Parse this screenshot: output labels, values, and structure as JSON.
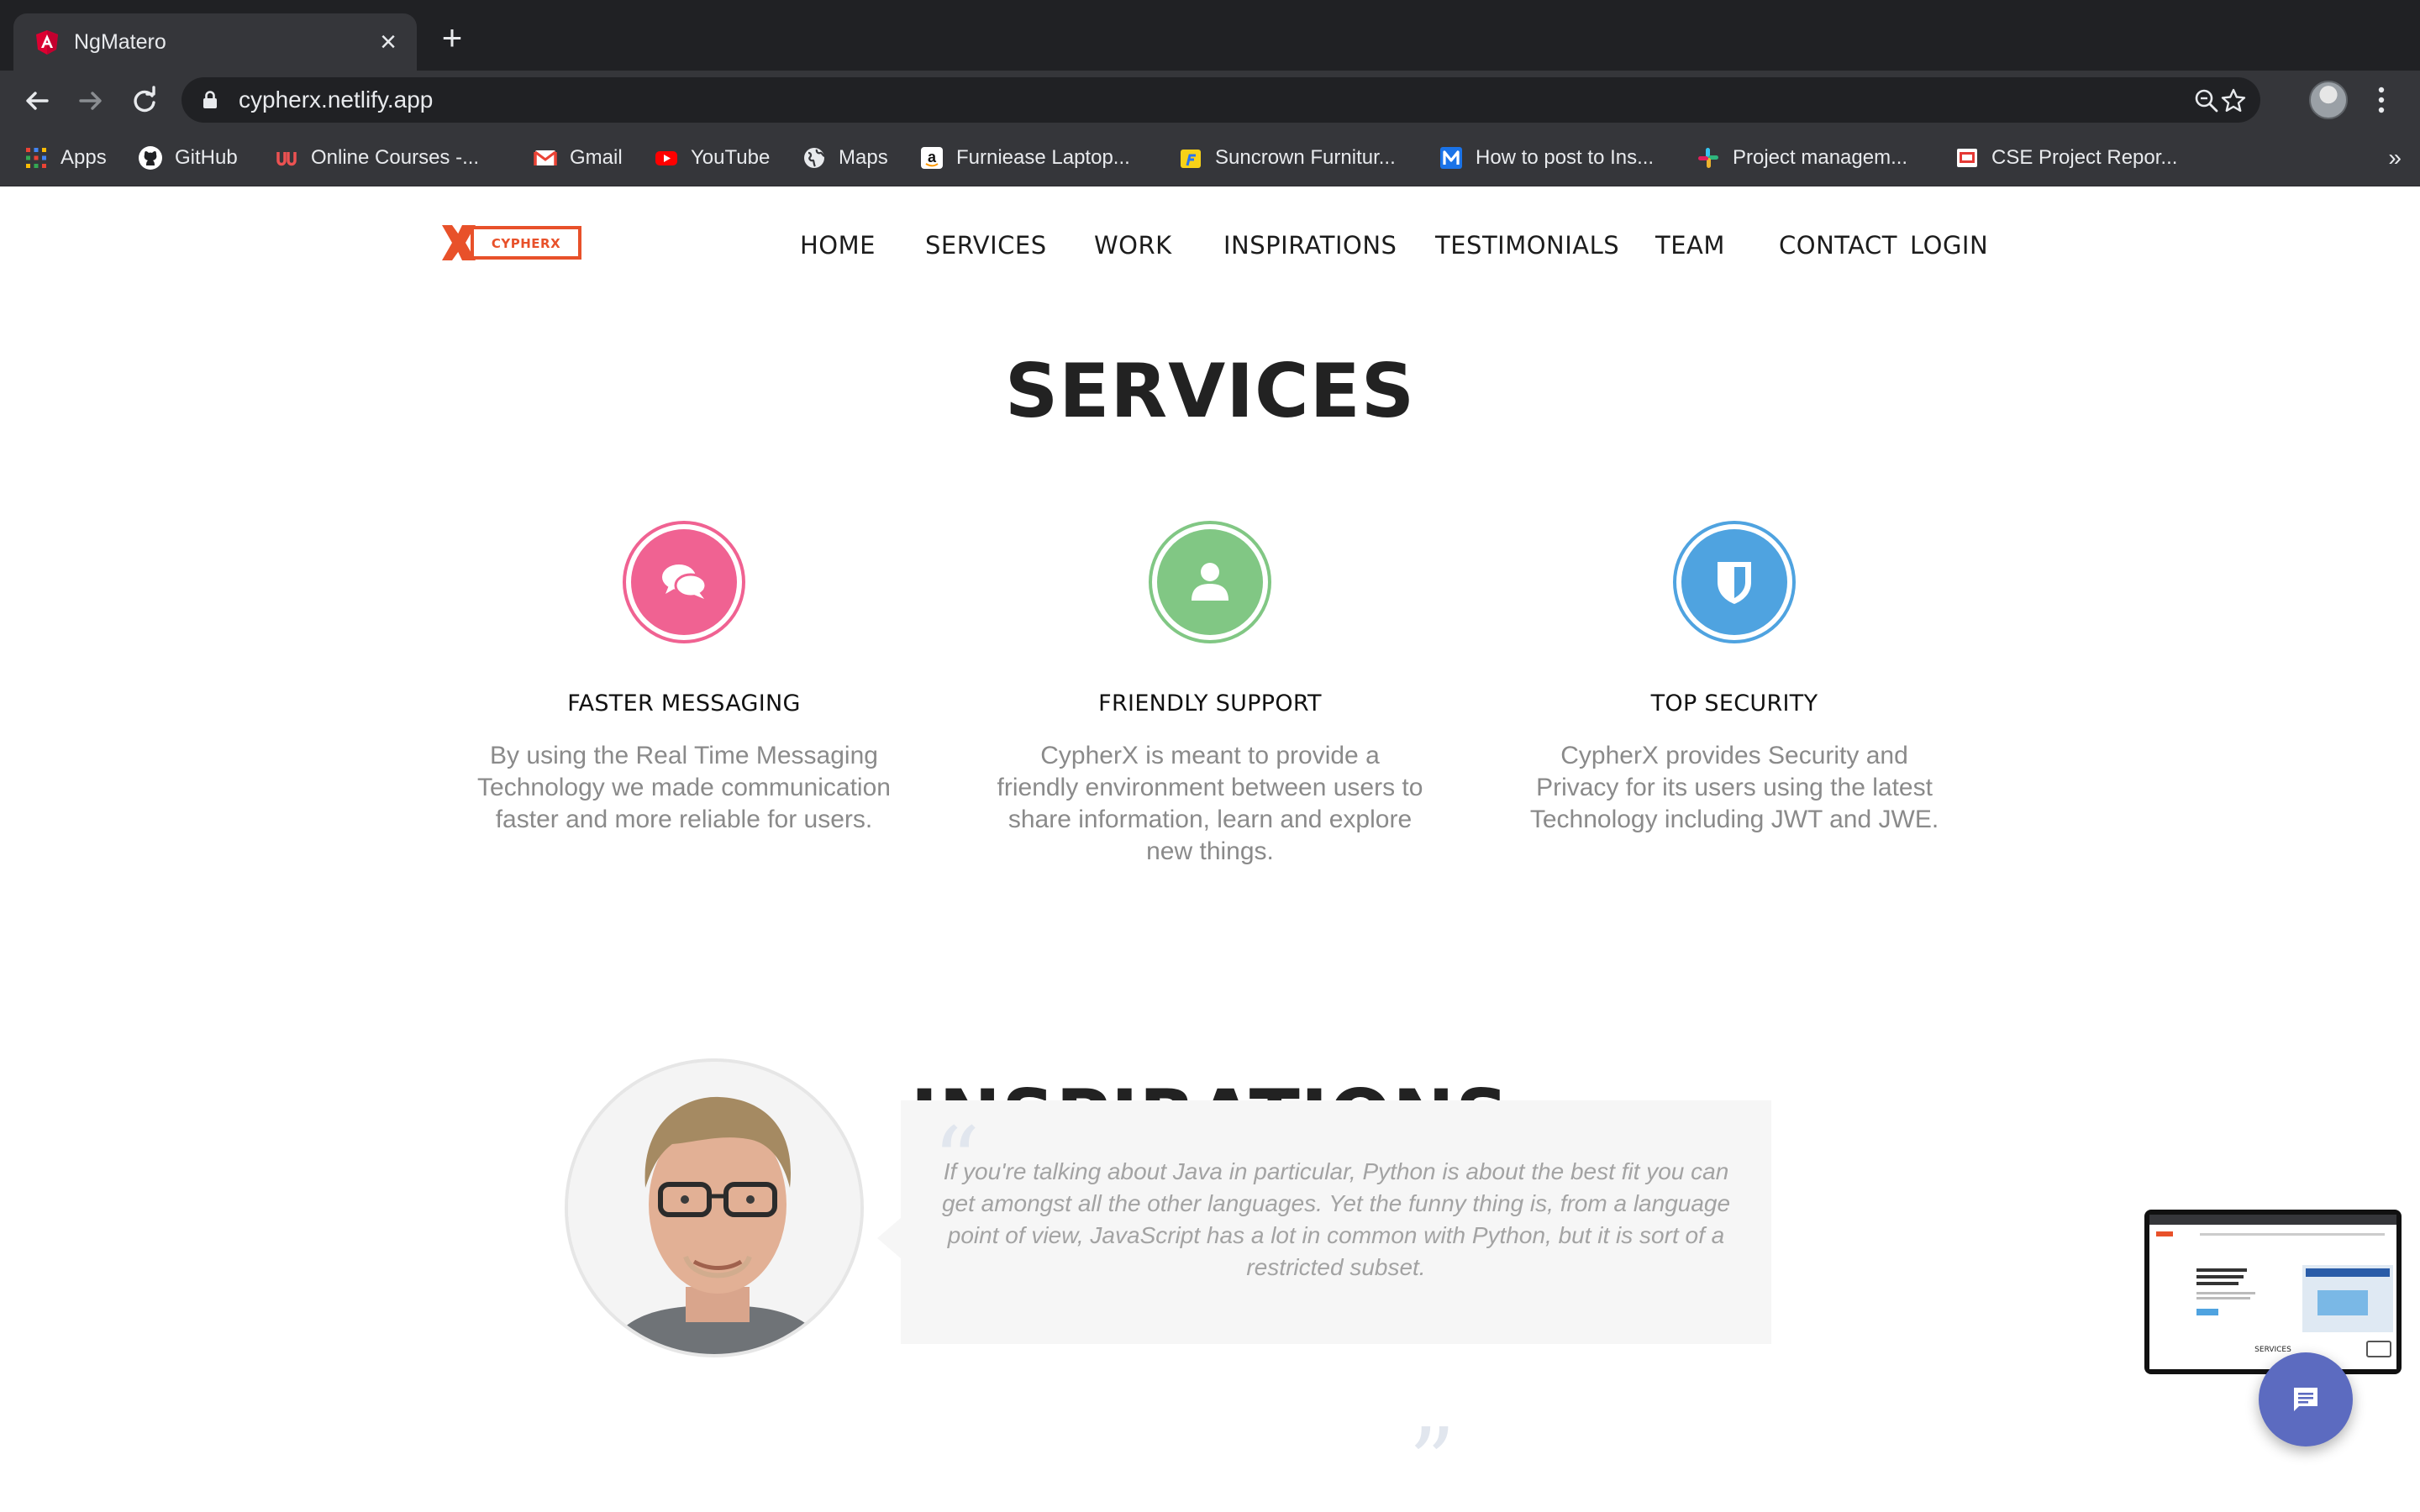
{
  "browser": {
    "tab_title": "NgMatero",
    "new_tab_label": "+",
    "close_label": "×",
    "url": "cypherx.netlify.app",
    "bookmarks": [
      {
        "label": "Apps",
        "icon": "apps-grid-icon"
      },
      {
        "label": "GitHub",
        "icon": "github-icon"
      },
      {
        "label": "Online Courses -...",
        "icon": "udemy-icon"
      },
      {
        "label": "Gmail",
        "icon": "gmail-icon"
      },
      {
        "label": "YouTube",
        "icon": "youtube-icon"
      },
      {
        "label": "Maps",
        "icon": "maps-icon"
      },
      {
        "label": "Furniease Laptop...",
        "icon": "amazon-icon"
      },
      {
        "label": "Suncrown Furnitur...",
        "icon": "flipkart-icon"
      },
      {
        "label": "How to post to Ins...",
        "icon": "medium-icon"
      },
      {
        "label": "Project managem...",
        "icon": "slack-icon"
      },
      {
        "label": "CSE Project Repor...",
        "icon": "slides-icon"
      }
    ],
    "more_bookmarks": "»"
  },
  "site": {
    "logo_text": "CYPHERX",
    "nav": [
      "HOME",
      "SERVICES",
      "WORK",
      "INSPIRATIONS",
      "TESTIMONIALS",
      "TEAM",
      "CONTACT",
      "LOGIN"
    ],
    "services_title": "SERVICES",
    "services": [
      {
        "title": "FASTER MESSAGING",
        "text": "By using the Real Time Messaging Technology we made communication faster and more reliable for users.",
        "icon": "chat-bubbles-icon",
        "color": "#f06292"
      },
      {
        "title": "FRIENDLY SUPPORT",
        "text": "CypherX is meant to provide a friendly environment between users to share information, learn and explore new things.",
        "icon": "user-icon",
        "color": "#81c784"
      },
      {
        "title": "TOP SECURITY",
        "text": "CypherX provides Security and Privacy for its users using the latest Technology including JWT and JWE.",
        "icon": "shield-icon",
        "color": "#4fa3e0"
      }
    ],
    "inspirations_title": "INSPIRATIONS",
    "quote": "If you're talking about Java in particular, Python is about the best fit you can get amongst all the other languages. Yet the funny thing is, from a language point of view, JavaScript has a lot in common with Python, but it is sort of a restricted subset.",
    "pip_caption": "SERVICES"
  },
  "colors": {
    "chrome_dark": "#202124",
    "chrome_mid": "#35363a",
    "brand_red": "#e8512a",
    "fab": "#5c6bc0"
  }
}
